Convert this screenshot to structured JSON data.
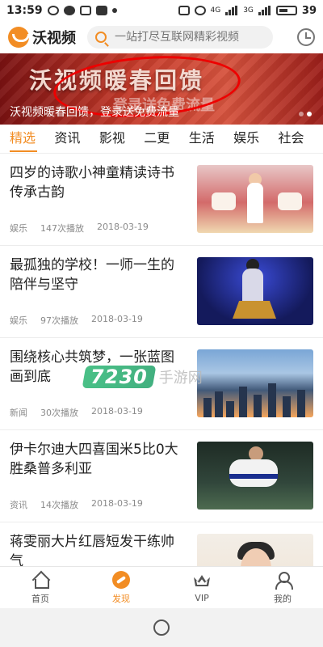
{
  "status_bar": {
    "time": "13:59",
    "battery": "39",
    "network_1": "4G",
    "network_2": "3G"
  },
  "app": {
    "logo_text": "沃视频",
    "search_placeholder": "一站打尽互联网精彩视频"
  },
  "banner": {
    "big_text": "沃视频暖春回馈",
    "sub_text": "登录送免费流量",
    "caption": "沃视频暖春回馈，登录送免费流量",
    "dots": 2,
    "active_dot": 1
  },
  "tabs": [
    {
      "label": "精选",
      "active": true
    },
    {
      "label": "资讯",
      "active": false
    },
    {
      "label": "影视",
      "active": false
    },
    {
      "label": "二更",
      "active": false
    },
    {
      "label": "生活",
      "active": false
    },
    {
      "label": "娱乐",
      "active": false
    },
    {
      "label": "社会",
      "active": false
    }
  ],
  "feed": [
    {
      "title": "四岁的诗歌小神童精读诗书传承古韵",
      "category": "娱乐",
      "plays": "147次播放",
      "date": "2018-03-19"
    },
    {
      "title": "最孤独的学校！一师一生的陪伴与坚守",
      "category": "娱乐",
      "plays": "97次播放",
      "date": "2018-03-19"
    },
    {
      "title": "围绕核心共筑梦，一张蓝图画到底",
      "category": "新闻",
      "plays": "30次播放",
      "date": "2018-03-19"
    },
    {
      "title": "伊卡尔迪大四喜国米5比0大胜桑普多利亚",
      "category": "资讯",
      "plays": "14次播放",
      "date": "2018-03-19"
    },
    {
      "title": "蒋雯丽大片红唇短发干练帅气",
      "category": "",
      "plays": "",
      "date": ""
    }
  ],
  "watermark": {
    "badge": "7230",
    "text": "手游网"
  },
  "bottom_nav": [
    {
      "label": "首页",
      "active": false
    },
    {
      "label": "发现",
      "active": true
    },
    {
      "label": "VIP",
      "active": false
    },
    {
      "label": "我的",
      "active": false
    }
  ],
  "colors": {
    "accent": "#f28d24",
    "banner_red": "#c43a2a"
  }
}
